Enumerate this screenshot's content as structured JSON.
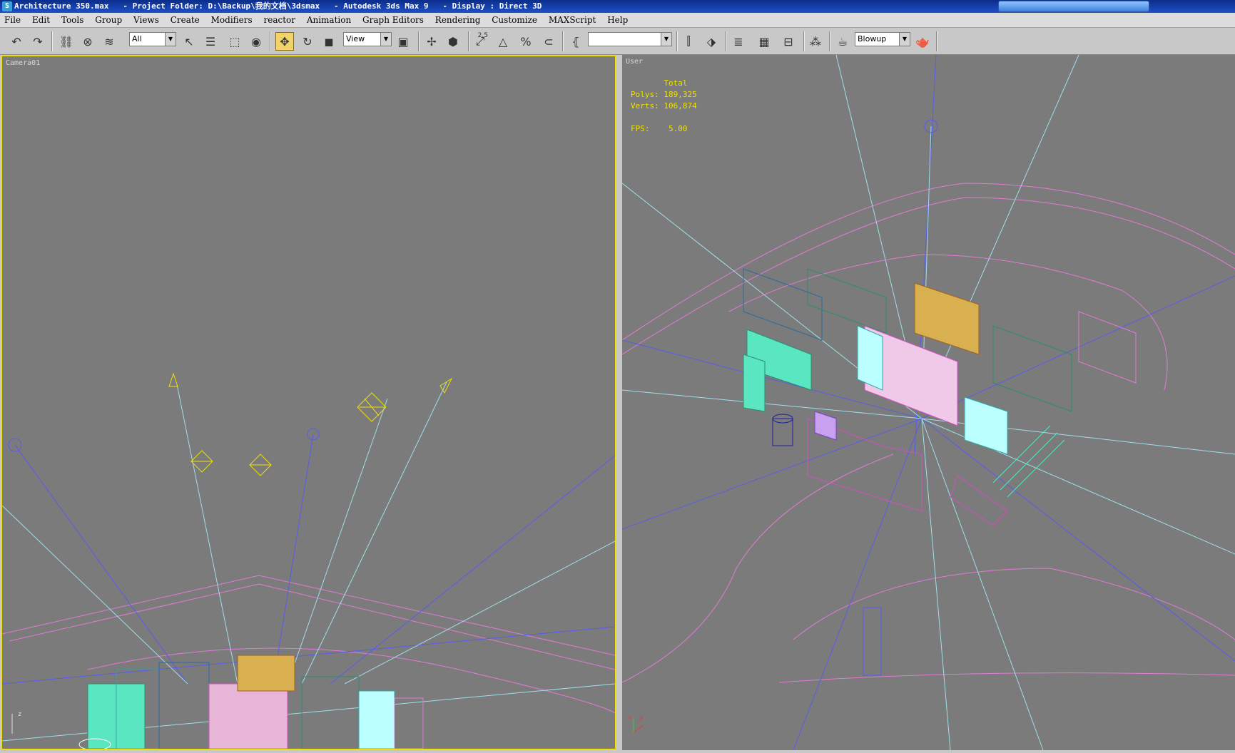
{
  "window": {
    "file": "Architecture 350.max",
    "project": "- Project Folder: D:\\Backup\\我的文档\\3dsmax",
    "app": "- Autodesk 3ds Max 9",
    "display": "- Display : Direct 3D"
  },
  "menu": [
    "File",
    "Edit",
    "Tools",
    "Group",
    "Views",
    "Create",
    "Modifiers",
    "reactor",
    "Animation",
    "Graph Editors",
    "Rendering",
    "Customize",
    "MAXScript",
    "Help"
  ],
  "toolbar": {
    "selection_filter": "All",
    "reference_coord": "View",
    "named_selection": "",
    "render_type": "Blowup",
    "snap_angle_label": "2.5"
  },
  "viewports": {
    "left": {
      "label": "Camera01"
    },
    "right": {
      "label": "User",
      "stats_header": "Total",
      "polys_label": "Polys:",
      "polys_value": "189,325",
      "verts_label": "Verts:",
      "verts_value": "106,874",
      "fps_label": "FPS:",
      "fps_value": "5.00"
    }
  },
  "axis": {
    "x": "x",
    "y": "y",
    "z": "z"
  },
  "colors": {
    "viewport_bg": "#7b7b7b",
    "active_border": "#f0e000",
    "wire_pink": "#e27bd6",
    "wire_cyan": "#9fdfe8",
    "wire_blue": "#5a5af0",
    "camera_yellow": "#f0e000",
    "building_teal": "#59e6c0"
  }
}
